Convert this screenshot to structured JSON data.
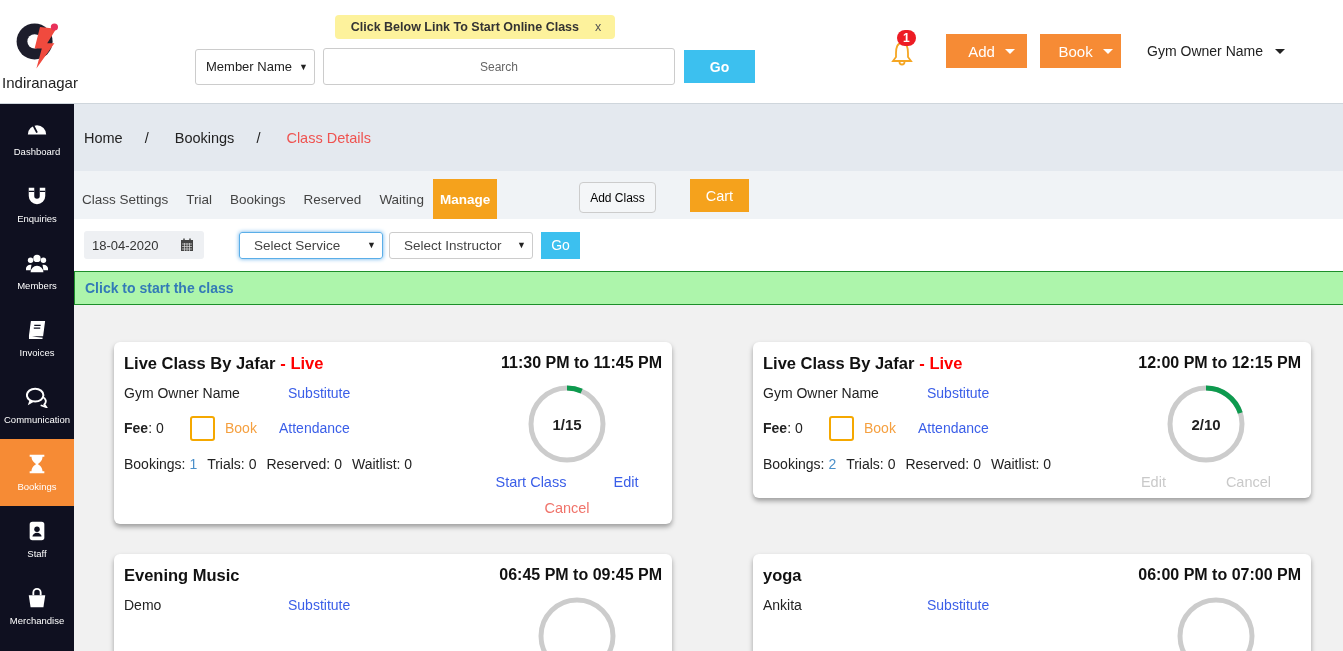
{
  "header": {
    "location": "Indiranagar",
    "notice": {
      "text": "Click Below Link To Start Online Class",
      "close": "x"
    },
    "search": {
      "filter": "Member Name",
      "filter_arrow": "▼",
      "placeholder": "Search",
      "button": "Go"
    },
    "notifications": {
      "count": "1"
    },
    "menus": [
      {
        "label": "Add"
      },
      {
        "label": "Book"
      }
    ],
    "user": "Gym Owner Name"
  },
  "sidebar": {
    "items": [
      {
        "label": "Dashboard",
        "selected": false
      },
      {
        "label": "Enquiries",
        "selected": false
      },
      {
        "label": "Members",
        "selected": false
      },
      {
        "label": "Invoices",
        "selected": false
      },
      {
        "label": "Communication",
        "selected": false
      },
      {
        "label": "Bookings",
        "selected": true
      },
      {
        "label": "Staff",
        "selected": false
      },
      {
        "label": "Merchandise",
        "selected": false
      }
    ]
  },
  "breadcrumb": [
    {
      "label": "Home",
      "separator": "/",
      "current": false
    },
    {
      "label": "Bookings",
      "separator": "/",
      "current": false
    },
    {
      "label": "Class Details",
      "current": true
    }
  ],
  "tabs": [
    {
      "label": "Class Settings",
      "selected": false
    },
    {
      "label": "Trial",
      "selected": false
    },
    {
      "label": "Bookings",
      "selected": false
    },
    {
      "label": "Reserved",
      "selected": false
    },
    {
      "label": "Waiting",
      "selected": false
    },
    {
      "label": "Manage",
      "selected": true
    }
  ],
  "tab_actions": {
    "add_class": "Add Class",
    "cart": "Cart"
  },
  "filters": {
    "date": "18-04-2020",
    "selects": [
      {
        "label": "Select Service",
        "arrow": "▼",
        "focused": true
      },
      {
        "label": "Select Instructor",
        "arrow": "▼",
        "focused": false
      }
    ],
    "button": "Go"
  },
  "banner": "Click to start the class",
  "classes": [
    {
      "title": "Live Class By Jafar",
      "live_label": "- Live",
      "time": "11:30 PM to 11:45 PM",
      "instructor": "Gym Owner Name",
      "substitute": "Substitute",
      "fee_label": "Fee",
      "fee": ": 0",
      "book": {
        "label": "Book",
        "checked": false
      },
      "attendance": "Attendance",
      "stats": [
        {
          "label": "Bookings:",
          "value": "1",
          "kind": "link"
        },
        {
          "label": "Trials:",
          "value": "0",
          "kind": "plain"
        },
        {
          "label": "Reserved:",
          "value": "0",
          "kind": "plain"
        },
        {
          "label": "Waitlist:",
          "value": "0",
          "kind": "plain"
        }
      ],
      "capacity": "1/15",
      "level": 0.0667,
      "actions": [
        {
          "label": "Start Class",
          "kind": "start",
          "disabled": false
        },
        {
          "label": "Edit",
          "kind": "edit",
          "disabled": false
        },
        {
          "label": "Cancel",
          "kind": "cancel",
          "disabled": false
        }
      ]
    },
    {
      "title": "Live Class By Jafar",
      "live_label": "- Live",
      "time": "12:00 PM to 12:15 PM",
      "instructor": "Gym Owner Name",
      "substitute": "Substitute",
      "fee_label": "Fee",
      "fee": ": 0",
      "book": {
        "label": "Book",
        "checked": false
      },
      "attendance": "Attendance",
      "stats": [
        {
          "label": "Bookings:",
          "value": "2",
          "kind": "link"
        },
        {
          "label": "Trials:",
          "value": "0",
          "kind": "plain"
        },
        {
          "label": "Reserved:",
          "value": "0",
          "kind": "plain"
        },
        {
          "label": "Waitlist:",
          "value": "0",
          "kind": "plain"
        }
      ],
      "capacity": "2/10",
      "level": 0.2,
      "actions": [
        {
          "label": "Edit",
          "kind": "edit",
          "disabled": true
        },
        {
          "label": "Cancel",
          "kind": "cancel",
          "disabled": true
        }
      ]
    },
    {
      "title": "Evening Music",
      "time": "06:45 PM to 09:45 PM",
      "instructor": "Demo",
      "substitute": "Substitute"
    },
    {
      "title": "yoga",
      "time": "06:00 PM to 07:00 PM",
      "instructor": "Ankita",
      "substitute": "Substitute"
    }
  ]
}
